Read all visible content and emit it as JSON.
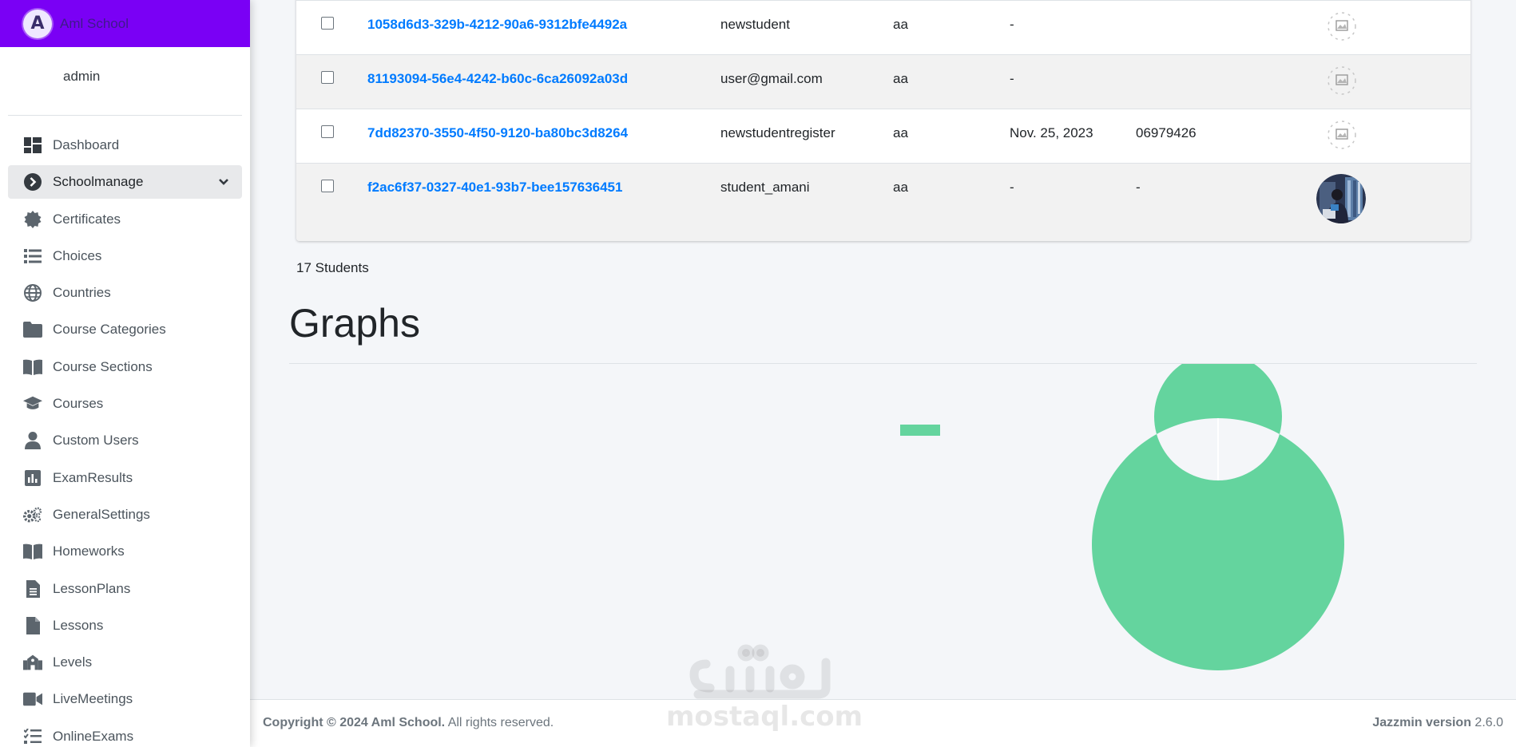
{
  "brand": {
    "name": "Aml School",
    "logo_letter": "A"
  },
  "user": {
    "name": "admin"
  },
  "sidebar": {
    "items": [
      {
        "label": "Dashboard",
        "icon": "dashboard-icon"
      },
      {
        "label": "Schoolmanage",
        "icon": "chevron-circle-right-icon",
        "active": true
      },
      {
        "label": "Certificates",
        "icon": "certificate-icon"
      },
      {
        "label": "Choices",
        "icon": "list-icon"
      },
      {
        "label": "Countries",
        "icon": "globe-icon"
      },
      {
        "label": "Course Categories",
        "icon": "folder-icon"
      },
      {
        "label": "Course Sections",
        "icon": "book-open-icon"
      },
      {
        "label": "Courses",
        "icon": "graduation-cap-icon"
      },
      {
        "label": "Custom Users",
        "icon": "user-icon"
      },
      {
        "label": "ExamResults",
        "icon": "chart-bar-icon"
      },
      {
        "label": "GeneralSettings",
        "icon": "cogs-icon"
      },
      {
        "label": "Homeworks",
        "icon": "book-open-icon"
      },
      {
        "label": "LessonPlans",
        "icon": "file-alt-icon"
      },
      {
        "label": "Lessons",
        "icon": "file-icon"
      },
      {
        "label": "Levels",
        "icon": "school-icon"
      },
      {
        "label": "LiveMeetings",
        "icon": "video-icon"
      },
      {
        "label": "OnlineExams",
        "icon": "tasks-icon"
      }
    ]
  },
  "table": {
    "rows": [
      {
        "id": "1058d6d3-329b-4212-90a6-9312bfe4492a",
        "username": "newstudent",
        "name": "aa",
        "date": "-",
        "phone": "",
        "image": "broken-image-icon"
      },
      {
        "id": "81193094-56e4-4242-b60c-6ca26092a03d",
        "username": "user@gmail.com",
        "name": "aa",
        "date": "-",
        "phone": "",
        "image": "broken-image-icon"
      },
      {
        "id": "7dd82370-3550-4f50-9120-ba80bc3d8264",
        "username": "newstudentregister",
        "name": "aa",
        "date": "Nov. 25, 2023",
        "phone": "06979426",
        "image": "broken-image-icon"
      },
      {
        "id": "f2ac6f37-0327-40e1-93b7-bee157636451",
        "username": "student_amani",
        "name": "aa",
        "date": "-",
        "phone": "-",
        "image": "avatar-photo"
      }
    ],
    "count_label": "17 Students"
  },
  "graphs": {
    "title": "Graphs"
  },
  "chart_data": {
    "type": "pie",
    "title": "",
    "categories": [
      ""
    ],
    "values": [
      1
    ],
    "colors": [
      "#64d49e"
    ],
    "legend": "top"
  },
  "footer": {
    "copyright_bold": "Copyright © 2024 Aml School.",
    "copyright_rest": " All rights reserved.",
    "version_label": "Jazzmin version",
    "version_value": " 2.6.0"
  },
  "watermark": {
    "arabic": "مستقل",
    "latin": "mostaql.com"
  },
  "colors": {
    "brand": "#7a00f5",
    "link": "#007bff",
    "chart": "#64d49e"
  }
}
